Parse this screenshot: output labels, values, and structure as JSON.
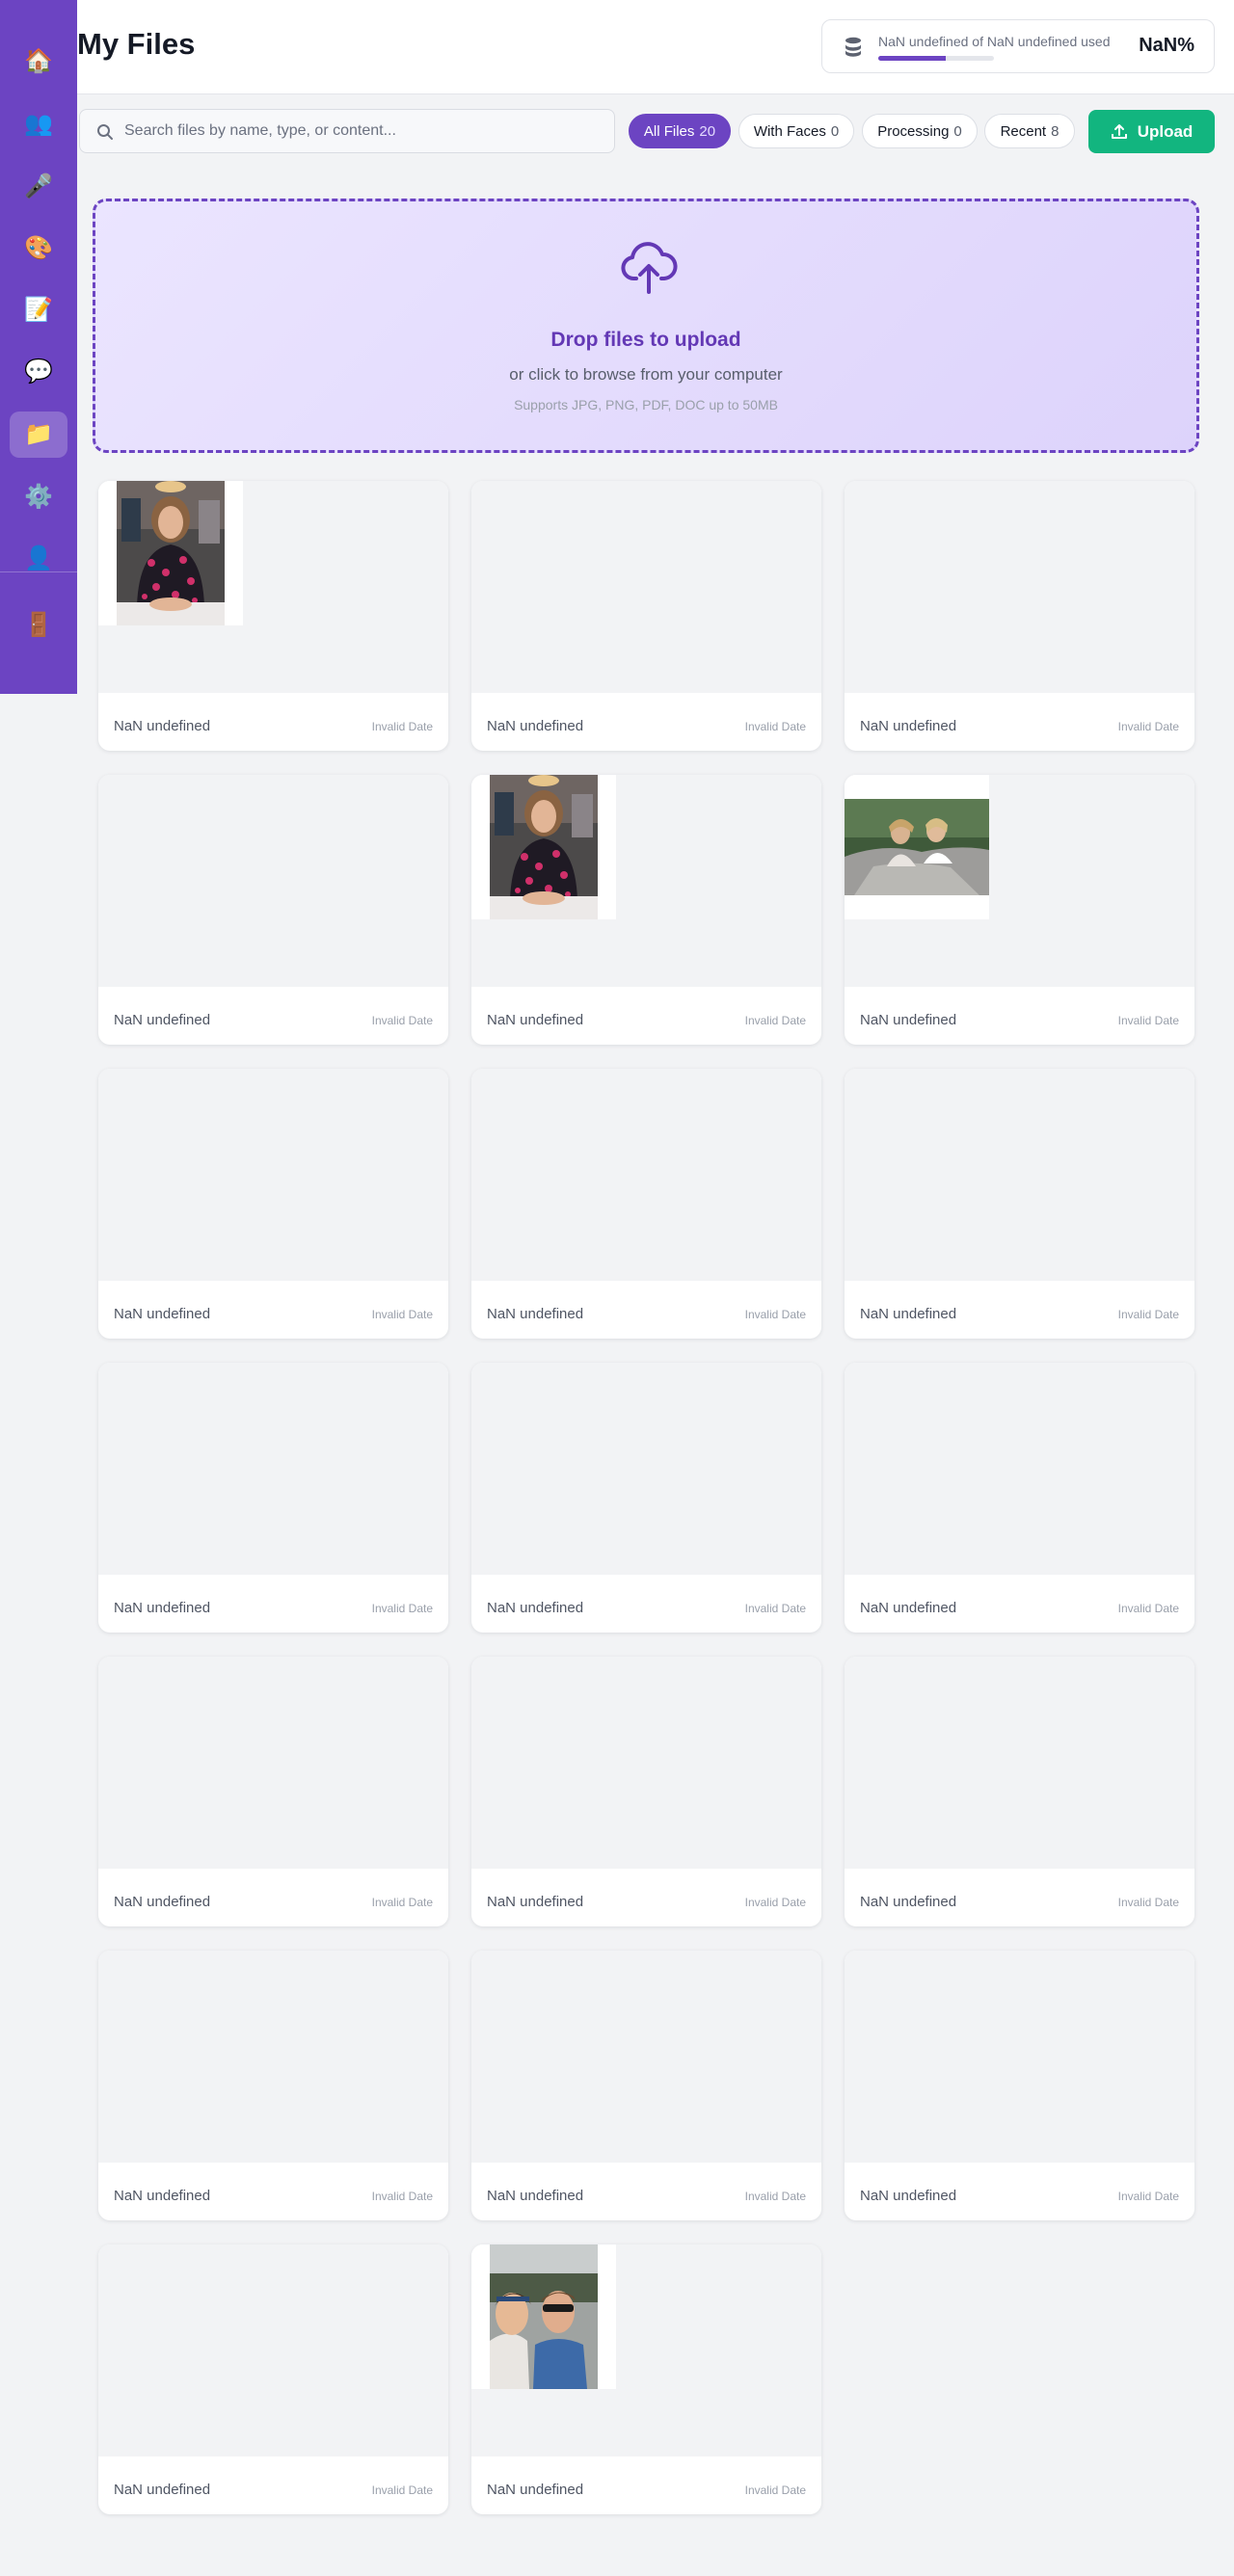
{
  "sidebar": {
    "items": [
      {
        "icon": "home-icon",
        "glyph": "🏠"
      },
      {
        "icon": "users-icon",
        "glyph": "👥"
      },
      {
        "icon": "microphone-icon",
        "glyph": "🎤"
      },
      {
        "icon": "palette-icon",
        "glyph": "🎨"
      },
      {
        "icon": "memo-icon",
        "glyph": "📝"
      },
      {
        "icon": "chat-icon",
        "glyph": "💬"
      },
      {
        "icon": "folder-icon",
        "glyph": "📁"
      },
      {
        "icon": "settings-icon",
        "glyph": "⚙️"
      },
      {
        "icon": "user-icon",
        "glyph": "👤"
      },
      {
        "icon": "logout-door-icon",
        "glyph": "🚪"
      }
    ],
    "active_item": "folder-icon"
  },
  "header": {
    "title": "My Files",
    "storage": {
      "text": "NaN undefined of NaN undefined used",
      "percent_label": "NaN%",
      "fill_fraction": 0.58
    }
  },
  "toolbar": {
    "search_placeholder": "Search files by name, type, or content...",
    "search_value": "",
    "filters": [
      {
        "label": "All Files",
        "count": "20",
        "active": true
      },
      {
        "label": "With Faces",
        "count": "0",
        "active": false
      },
      {
        "label": "Processing",
        "count": "0",
        "active": false
      },
      {
        "label": "Recent",
        "count": "8",
        "active": false
      }
    ],
    "upload_label": "Upload"
  },
  "dropzone": {
    "title": "Drop files to upload",
    "subtitle": "or click to browse from your computer",
    "note": "Supports JPG, PNG, PDF, DOC up to 50MB"
  },
  "files": [
    {
      "name": "NaN undefined",
      "date": "Invalid Date",
      "thumb": "portrait-woman"
    },
    {
      "name": "NaN undefined",
      "date": "Invalid Date",
      "thumb": "none"
    },
    {
      "name": "NaN undefined",
      "date": "Invalid Date",
      "thumb": "none"
    },
    {
      "name": "NaN undefined",
      "date": "Invalid Date",
      "thumb": "none"
    },
    {
      "name": "NaN undefined",
      "date": "Invalid Date",
      "thumb": "portrait-woman"
    },
    {
      "name": "NaN undefined",
      "date": "Invalid Date",
      "thumb": "landscape-group"
    },
    {
      "name": "NaN undefined",
      "date": "Invalid Date",
      "thumb": "none"
    },
    {
      "name": "NaN undefined",
      "date": "Invalid Date",
      "thumb": "none"
    },
    {
      "name": "NaN undefined",
      "date": "Invalid Date",
      "thumb": "none"
    },
    {
      "name": "NaN undefined",
      "date": "Invalid Date",
      "thumb": "none"
    },
    {
      "name": "NaN undefined",
      "date": "Invalid Date",
      "thumb": "none"
    },
    {
      "name": "NaN undefined",
      "date": "Invalid Date",
      "thumb": "none"
    },
    {
      "name": "NaN undefined",
      "date": "Invalid Date",
      "thumb": "none"
    },
    {
      "name": "NaN undefined",
      "date": "Invalid Date",
      "thumb": "none"
    },
    {
      "name": "NaN undefined",
      "date": "Invalid Date",
      "thumb": "none"
    },
    {
      "name": "NaN undefined",
      "date": "Invalid Date",
      "thumb": "none"
    },
    {
      "name": "NaN undefined",
      "date": "Invalid Date",
      "thumb": "none"
    },
    {
      "name": "NaN undefined",
      "date": "Invalid Date",
      "thumb": "none"
    },
    {
      "name": "NaN undefined",
      "date": "Invalid Date",
      "thumb": "none"
    },
    {
      "name": "NaN undefined",
      "date": "Invalid Date",
      "thumb": "selfie-couple"
    }
  ],
  "colors": {
    "brand": "#6c44c2",
    "upload": "#12b57f",
    "background": "#f2f3f5"
  }
}
